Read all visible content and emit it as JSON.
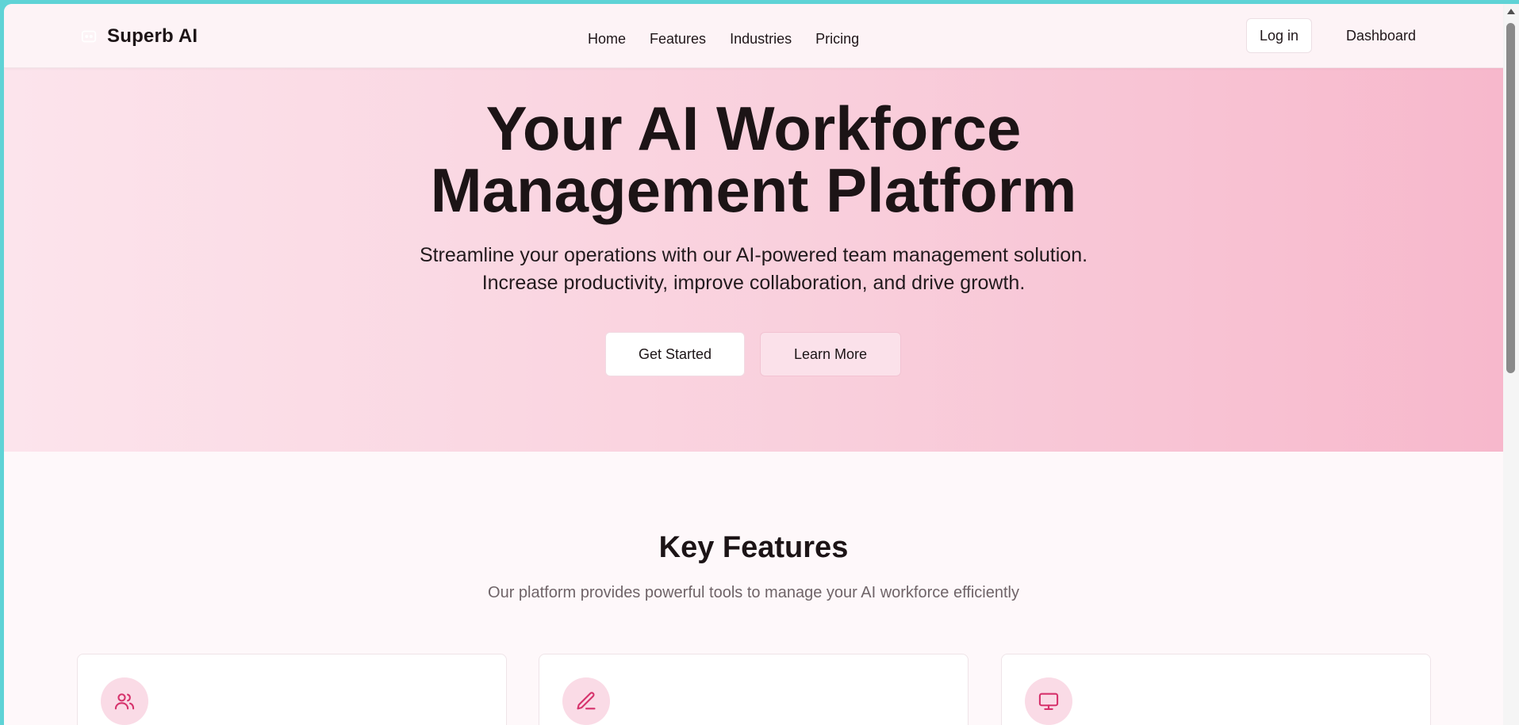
{
  "header": {
    "brand_name": "Superb AI",
    "nav": [
      "Home",
      "Features",
      "Industries",
      "Pricing"
    ],
    "login_label": "Log in",
    "dashboard_label": "Dashboard"
  },
  "hero": {
    "title_line1": "Your AI Workforce",
    "title_line2": "Management Platform",
    "subtitle_line1": "Streamline your operations with our AI-powered team management solution.",
    "subtitle_line2": "Increase productivity, improve collaboration, and drive growth.",
    "primary_button": "Get Started",
    "secondary_button": "Learn More"
  },
  "features": {
    "title": "Key Features",
    "subtitle": "Our platform provides powerful tools to manage your AI workforce efficiently",
    "cards": [
      {
        "icon": "users-icon"
      },
      {
        "icon": "pen-icon"
      },
      {
        "icon": "monitor-icon"
      }
    ]
  },
  "colors": {
    "accent": "#d6336c",
    "hero_start": "#fce4ec",
    "hero_end": "#f7b8cc",
    "icon_bg": "#fadbe6"
  }
}
